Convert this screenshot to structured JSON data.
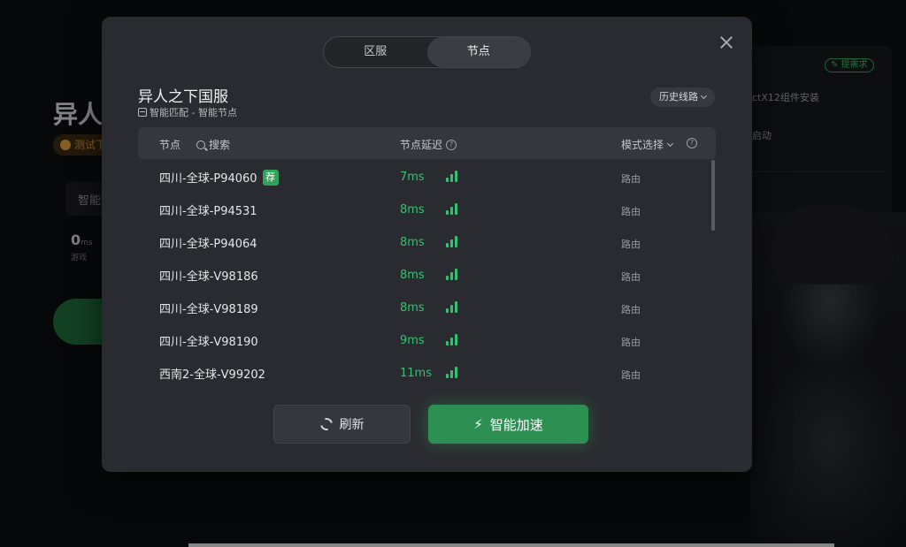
{
  "background": {
    "game_title": "异人",
    "test_badge": "测试下",
    "smart_label": "智能",
    "ping_value": "0",
    "ping_unit": "ms",
    "ping_sub": "游戏",
    "feedback": "提需求",
    "directx": "ctX12组件安装",
    "autostart": "启动"
  },
  "modal": {
    "tabs": [
      {
        "label": "区服",
        "active": false
      },
      {
        "label": "节点",
        "active": true
      }
    ],
    "game_name": "异人之下国服",
    "match_info": "智能匹配 - 智能节点",
    "history_button": "历史线路",
    "table_header": {
      "node": "节点",
      "search": "搜索",
      "latency": "节点延迟",
      "mode": "模式选择",
      "help": "?"
    },
    "nodes": [
      {
        "name": "四川-全球-P94060",
        "recommended": true,
        "recommend_label": "荐",
        "latency": "7ms",
        "mode": "路由"
      },
      {
        "name": "四川-全球-P94531",
        "recommended": false,
        "latency": "8ms",
        "mode": "路由"
      },
      {
        "name": "四川-全球-P94064",
        "recommended": false,
        "latency": "8ms",
        "mode": "路由"
      },
      {
        "name": "四川-全球-V98186",
        "recommended": false,
        "latency": "8ms",
        "mode": "路由"
      },
      {
        "name": "四川-全球-V98189",
        "recommended": false,
        "latency": "8ms",
        "mode": "路由"
      },
      {
        "name": "四川-全球-V98190",
        "recommended": false,
        "latency": "9ms",
        "mode": "路由"
      },
      {
        "name": "西南2-全球-V99202",
        "recommended": false,
        "latency": "11ms",
        "mode": "路由"
      }
    ],
    "refresh_button": "刷新",
    "accelerate_button": "智能加速"
  },
  "colors": {
    "accent_green": "#35c070",
    "button_green": "#2e8f52",
    "modal_bg": "#2a2b30"
  }
}
